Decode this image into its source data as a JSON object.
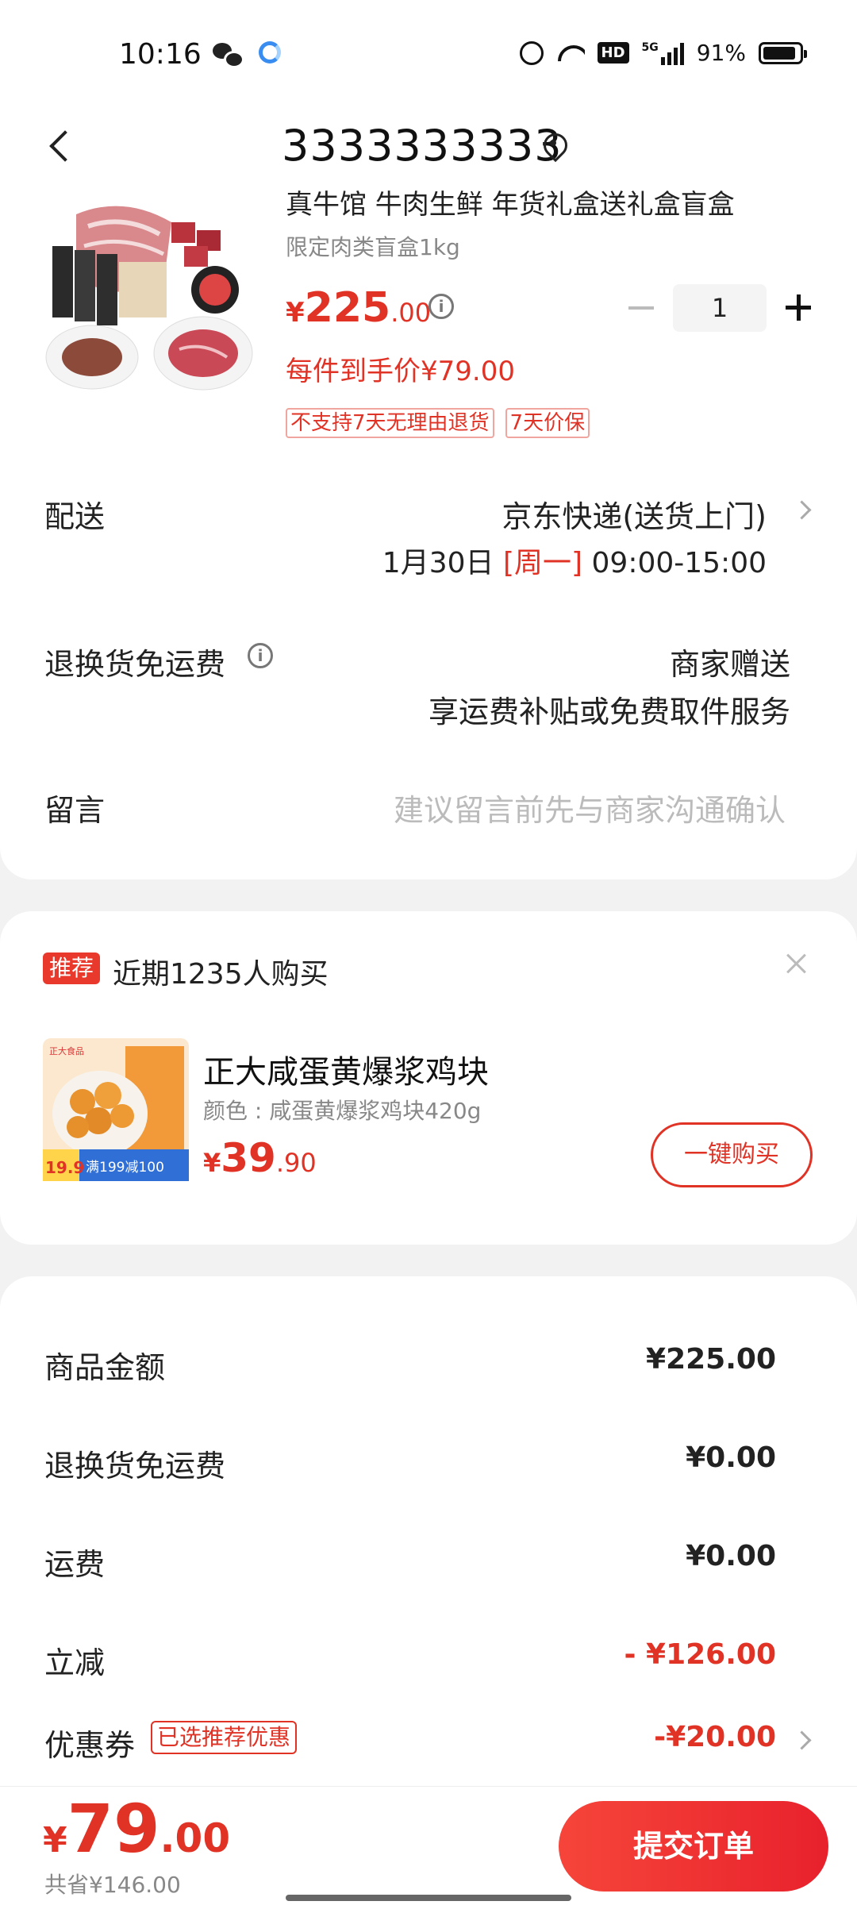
{
  "status_bar": {
    "time": "10:16",
    "battery": "91%",
    "network": "5G"
  },
  "header": {
    "title": "3333333333"
  },
  "product": {
    "name": "真牛馆 牛肉生鲜 年货礼盒送礼盒盲盒",
    "spec": "限定肉类盲盒1kg",
    "price_symbol": "¥",
    "price_int": "225",
    "price_dec": ".00",
    "quantity": "1",
    "unit_price": "每件到手价¥79.00",
    "tags": [
      "不支持7天无理由退货",
      "7天价保"
    ]
  },
  "delivery": {
    "label": "配送",
    "method": "京东快递(送货上门)",
    "date": "1月30日",
    "weekday": "[周一]",
    "time_window": "09:00-15:00"
  },
  "return_shipping": {
    "label": "退换货免运费",
    "value1": "商家赠送",
    "value2": "享运费补贴或免费取件服务"
  },
  "message": {
    "label": "留言",
    "placeholder": "建议留言前先与商家沟通确认"
  },
  "recommend": {
    "badge": "推荐",
    "title": "近期1235人购买",
    "name": "正大咸蛋黄爆浆鸡块",
    "spec": "颜色 : 咸蛋黄爆浆鸡块420g",
    "price_symbol": "¥",
    "price_int": "39",
    "price_dec": ".90",
    "button": "一键购买",
    "img_brand": "正大食品",
    "img_price": "19.9",
    "img_promo": "满199减100"
  },
  "summary": {
    "rows": [
      {
        "label": "商品金额",
        "value": "¥225.00"
      },
      {
        "label": "退换货免运费",
        "value": "¥0.00"
      },
      {
        "label": "运费",
        "value": "¥0.00"
      },
      {
        "label": "立减",
        "value": "- ¥126.00"
      },
      {
        "label": "优惠券",
        "value": "-¥20.00"
      }
    ],
    "coupon_tag": "已选推荐优惠"
  },
  "bottom_bar": {
    "price_symbol": "¥",
    "price_int": "79",
    "price_dec": ".00",
    "saved": "共省¥146.00",
    "submit": "提交订单"
  },
  "colors": {
    "accent": "#e03326",
    "background": "#f2f2f2"
  }
}
